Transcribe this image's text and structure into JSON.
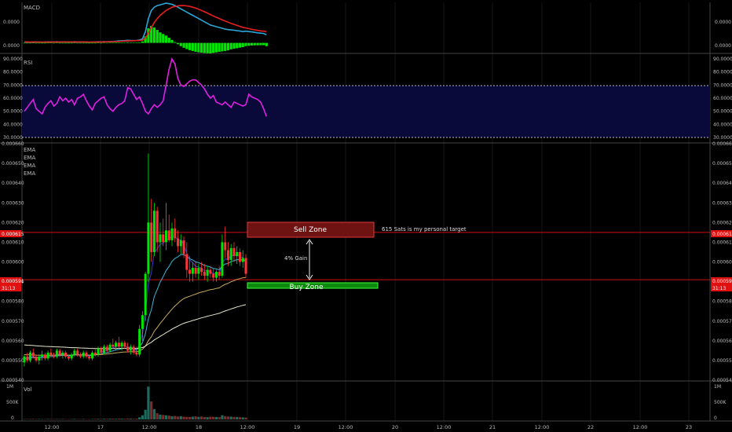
{
  "panels": {
    "macd": {
      "label": "MACD",
      "ticks": [
        "0.0000",
        "0.0000"
      ]
    },
    "rsi": {
      "label": "RSI",
      "ticks": [
        "90.0000",
        "80.0000",
        "70.0000",
        "60.0000",
        "50.0000",
        "40.0000",
        "30.0000"
      ]
    },
    "price": {
      "labels": [
        "EMA",
        "EMA",
        "EMA",
        "EMA"
      ]
    },
    "volume": {
      "label": "Vol",
      "ticks": [
        "1M",
        "500K",
        "0"
      ]
    }
  },
  "colors": {
    "bull": "#00e600",
    "bear": "#ff3333",
    "macd_line": "#2aa7d8",
    "signal_line": "#e82020",
    "rsi_line": "#e020e0",
    "rsi_band": "#0a0a3a",
    "ema1": "#3a36c8",
    "ema2": "#38b8d8",
    "ema3": "#c8a860",
    "ema4": "#e8e8d0",
    "level_line": "#cc1111",
    "sell_fill": "#6e1212",
    "buy_fill": "#0d8a0d"
  },
  "annotations": {
    "sell_zone": "Sell Zone",
    "buy_zone": "Buy Zone",
    "target_note": "615 Sats is my personal target",
    "gain_label": "4% Gain"
  },
  "levels": {
    "sell": {
      "label": "0.000615",
      "value": 0.000615
    },
    "buy": {
      "label": "0.000591",
      "value": 0.000591,
      "countdown": "31:13"
    }
  },
  "x_labels": [
    "12:00",
    "17",
    "12:00",
    "18",
    "12:00",
    "19",
    "12:00",
    "20",
    "12:00",
    "21",
    "12:00",
    "22",
    "12:00",
    "23"
  ],
  "chart_data": {
    "type": "candlestick",
    "price_axis": {
      "ticks": [
        0.00066,
        0.00065,
        0.00064,
        0.00063,
        0.00062,
        0.00061,
        0.0006,
        0.00059,
        0.00058,
        0.00057,
        0.00056,
        0.00055,
        0.00054
      ],
      "range": [
        0.00054,
        0.00066
      ]
    },
    "rsi": {
      "range": [
        30,
        90
      ],
      "overbought": 70,
      "oversold": 30,
      "values": [
        50,
        53,
        56,
        59,
        52,
        50,
        48,
        53,
        56,
        58,
        54,
        56,
        61,
        58,
        60,
        57,
        59,
        55,
        60,
        61,
        63,
        58,
        54,
        51,
        56,
        58,
        60,
        61,
        55,
        52,
        50,
        53,
        55,
        56,
        58,
        68,
        67,
        63,
        59,
        61,
        56,
        50,
        48,
        52,
        55,
        53,
        55,
        58,
        70,
        82,
        90,
        86,
        75,
        70,
        69,
        71,
        73,
        74,
        74,
        72,
        70,
        67,
        63,
        60,
        62,
        57,
        56,
        55,
        57,
        55,
        53,
        57,
        56,
        55,
        54,
        55,
        63,
        61,
        60,
        59,
        57,
        52,
        46
      ]
    },
    "macd": {
      "range": [
        -0.6,
        2.5
      ],
      "macd": [
        0.05,
        0.05,
        0.04,
        0.06,
        0.05,
        0.05,
        0.04,
        0.05,
        0.06,
        0.06,
        0.06,
        0.07,
        0.05,
        0.06,
        0.06,
        0.05,
        0.05,
        0.07,
        0.06,
        0.06,
        0.06,
        0.05,
        0.04,
        0.05,
        0.05,
        0.07,
        0.06,
        0.08,
        0.07,
        0.08,
        0.09,
        0.1,
        0.12,
        0.13,
        0.14,
        0.16,
        0.15,
        0.14,
        0.15,
        0.18,
        0.25,
        0.7,
        1.5,
        2.0,
        2.2,
        2.3,
        2.35,
        2.4,
        2.45,
        2.42,
        2.38,
        2.3,
        2.2,
        2.1,
        2.0,
        1.9,
        1.8,
        1.7,
        1.6,
        1.5,
        1.4,
        1.3,
        1.2,
        1.1,
        1.05,
        1.0,
        0.95,
        0.9,
        0.85,
        0.82,
        0.8,
        0.78,
        0.75,
        0.73,
        0.7,
        0.72,
        0.7,
        0.68,
        0.65,
        0.62,
        0.6,
        0.58,
        0.5
      ],
      "signal": [
        0.06,
        0.06,
        0.05,
        0.05,
        0.05,
        0.05,
        0.05,
        0.05,
        0.05,
        0.05,
        0.06,
        0.06,
        0.06,
        0.06,
        0.06,
        0.06,
        0.06,
        0.06,
        0.06,
        0.06,
        0.06,
        0.06,
        0.05,
        0.05,
        0.05,
        0.06,
        0.06,
        0.06,
        0.07,
        0.07,
        0.08,
        0.08,
        0.09,
        0.1,
        0.11,
        0.12,
        0.13,
        0.13,
        0.14,
        0.15,
        0.16,
        0.3,
        0.6,
        0.95,
        1.25,
        1.5,
        1.7,
        1.85,
        2.0,
        2.1,
        2.2,
        2.25,
        2.28,
        2.3,
        2.3,
        2.28,
        2.25,
        2.2,
        2.15,
        2.08,
        2.0,
        1.92,
        1.84,
        1.75,
        1.66,
        1.58,
        1.5,
        1.42,
        1.35,
        1.28,
        1.2,
        1.14,
        1.08,
        1.02,
        0.96,
        0.92,
        0.88,
        0.84,
        0.8,
        0.77,
        0.74,
        0.72,
        0.7
      ],
      "hist": [
        -0.01,
        -0.01,
        -0.01,
        0.01,
        0,
        0,
        -0.01,
        0,
        0.01,
        0.01,
        0,
        0.01,
        -0.01,
        0,
        0,
        -0.01,
        -0.01,
        0.01,
        0,
        0,
        0,
        -0.01,
        -0.01,
        0,
        0,
        0.01,
        0,
        0.02,
        0,
        0.01,
        0.01,
        0.02,
        0.03,
        0.03,
        0.03,
        0.04,
        0.02,
        0.01,
        0.01,
        0.03,
        0.09,
        0.4,
        0.9,
        1.05,
        0.95,
        0.8,
        0.65,
        0.55,
        0.45,
        0.32,
        0.18,
        0.05,
        -0.08,
        -0.2,
        -0.3,
        -0.38,
        -0.45,
        -0.5,
        -0.55,
        -0.58,
        -0.6,
        -0.62,
        -0.64,
        -0.65,
        -0.61,
        -0.58,
        -0.55,
        -0.52,
        -0.5,
        -0.46,
        -0.4,
        -0.36,
        -0.33,
        -0.29,
        -0.26,
        -0.2,
        -0.18,
        -0.16,
        -0.15,
        -0.15,
        -0.14,
        -0.14,
        -0.2
      ]
    },
    "ohlc": [
      [
        0.000549,
        0.000553,
        0.000547,
        0.000552
      ],
      [
        0.000552,
        0.000554,
        0.000549,
        0.00055
      ],
      [
        0.00055,
        0.000555,
        0.000549,
        0.000554
      ],
      [
        0.000554,
        0.000556,
        0.000551,
        0.000552
      ],
      [
        0.000552,
        0.000553,
        0.000549,
        0.00055
      ],
      [
        0.00055,
        0.000553,
        0.000548,
        0.000552
      ],
      [
        0.000552,
        0.000555,
        0.00055,
        0.000553
      ],
      [
        0.000553,
        0.000554,
        0.00055,
        0.000551
      ],
      [
        0.000551,
        0.000555,
        0.00055,
        0.000554
      ],
      [
        0.000554,
        0.000556,
        0.000552,
        0.000553
      ],
      [
        0.000553,
        0.000554,
        0.000551,
        0.000552
      ],
      [
        0.000552,
        0.000556,
        0.000551,
        0.000555
      ],
      [
        0.000555,
        0.000556,
        0.000552,
        0.000553
      ],
      [
        0.000553,
        0.000555,
        0.000551,
        0.000554
      ],
      [
        0.000554,
        0.000555,
        0.000551,
        0.000552
      ],
      [
        0.000552,
        0.000553,
        0.00055,
        0.000551
      ],
      [
        0.000551,
        0.000554,
        0.00055,
        0.000553
      ],
      [
        0.000553,
        0.000556,
        0.000552,
        0.000555
      ],
      [
        0.000555,
        0.000556,
        0.000552,
        0.000553
      ],
      [
        0.000553,
        0.000554,
        0.000551,
        0.000552
      ],
      [
        0.000552,
        0.000555,
        0.000551,
        0.000554
      ],
      [
        0.000554,
        0.000555,
        0.000551,
        0.000552
      ],
      [
        0.000552,
        0.000553,
        0.00055,
        0.000551
      ],
      [
        0.000551,
        0.000555,
        0.00055,
        0.000554
      ],
      [
        0.000554,
        0.000556,
        0.000552,
        0.000553
      ],
      [
        0.000553,
        0.000557,
        0.000552,
        0.000556
      ],
      [
        0.000556,
        0.000557,
        0.000553,
        0.000554
      ],
      [
        0.000554,
        0.000558,
        0.000553,
        0.000557
      ],
      [
        0.000557,
        0.000558,
        0.000554,
        0.000555
      ],
      [
        0.000555,
        0.000559,
        0.000554,
        0.000558
      ],
      [
        0.000558,
        0.000561,
        0.000556,
        0.000557
      ],
      [
        0.000557,
        0.00056,
        0.000555,
        0.000559
      ],
      [
        0.000559,
        0.000562,
        0.000556,
        0.000557
      ],
      [
        0.000557,
        0.00056,
        0.000555,
        0.000559
      ],
      [
        0.000559,
        0.00056,
        0.000556,
        0.000557
      ],
      [
        0.000557,
        0.000559,
        0.000554,
        0.000555
      ],
      [
        0.000555,
        0.000558,
        0.000553,
        0.000557
      ],
      [
        0.000557,
        0.000558,
        0.000553,
        0.000554
      ],
      [
        0.000554,
        0.000557,
        0.000552,
        0.000553
      ],
      [
        0.000553,
        0.000568,
        0.000552,
        0.000566
      ],
      [
        0.000566,
        0.000575,
        0.00056,
        0.000573
      ],
      [
        0.000573,
        0.000595,
        0.00057,
        0.000594
      ],
      [
        0.000594,
        0.000655,
        0.00059,
        0.00062
      ],
      [
        0.00062,
        0.000632,
        0.0006,
        0.000605
      ],
      [
        0.000605,
        0.00063,
        0.000603,
        0.000626
      ],
      [
        0.000626,
        0.000628,
        0.000605,
        0.00061
      ],
      [
        0.00061,
        0.00062,
        0.0006,
        0.000614
      ],
      [
        0.000614,
        0.000622,
        0.000608,
        0.00061
      ],
      [
        0.00061,
        0.00063,
        0.000606,
        0.000616
      ],
      [
        0.000616,
        0.000624,
        0.00061,
        0.000611
      ],
      [
        0.000611,
        0.00062,
        0.000608,
        0.000617
      ],
      [
        0.000617,
        0.000622,
        0.00061,
        0.000612
      ],
      [
        0.000612,
        0.000616,
        0.000605,
        0.000608
      ],
      [
        0.000608,
        0.000614,
        0.000604,
        0.000611
      ],
      [
        0.000611,
        0.000613,
        0.000602,
        0.000604
      ],
      [
        0.000604,
        0.00061,
        0.000592,
        0.000596
      ],
      [
        0.000596,
        0.000603,
        0.00059,
        0.000594
      ],
      [
        0.000594,
        0.0006,
        0.00059,
        0.000597
      ],
      [
        0.000597,
        0.0006,
        0.000592,
        0.000594
      ],
      [
        0.000594,
        0.000599,
        0.000591,
        0.000597
      ],
      [
        0.000597,
        0.0006,
        0.000593,
        0.000595
      ],
      [
        0.000595,
        0.000599,
        0.000591,
        0.000593
      ],
      [
        0.000593,
        0.000598,
        0.00059,
        0.000596
      ],
      [
        0.000596,
        0.000598,
        0.000592,
        0.000594
      ],
      [
        0.000594,
        0.000597,
        0.00059,
        0.000592
      ],
      [
        0.000592,
        0.000596,
        0.00059,
        0.000595
      ],
      [
        0.000595,
        0.000598,
        0.000591,
        0.000593
      ],
      [
        0.000593,
        0.000614,
        0.000592,
        0.00061
      ],
      [
        0.00061,
        0.000618,
        0.000602,
        0.000606
      ],
      [
        0.000606,
        0.00061,
        0.000598,
        0.000601
      ],
      [
        0.000601,
        0.000609,
        0.000598,
        0.000607
      ],
      [
        0.000607,
        0.00061,
        0.0006,
        0.000603
      ],
      [
        0.000603,
        0.000608,
        0.000599,
        0.000605
      ],
      [
        0.000605,
        0.000607,
        0.000598,
        0.0006
      ],
      [
        0.0006,
        0.000606,
        0.000597,
        0.000602
      ],
      [
        0.000602,
        0.000604,
        0.000592,
        0.000594
      ]
    ],
    "volume": [
      10,
      12,
      8,
      15,
      9,
      11,
      8,
      10,
      14,
      12,
      9,
      11,
      10,
      13,
      9,
      8,
      12,
      14,
      10,
      11,
      13,
      9,
      8,
      12,
      15,
      18,
      12,
      20,
      16,
      22,
      25,
      20,
      28,
      24,
      20,
      26,
      22,
      18,
      24,
      60,
      120,
      280,
      950,
      520,
      300,
      180,
      140,
      130,
      120,
      110,
      90,
      100,
      85,
      95,
      80,
      75,
      70,
      80,
      90,
      75,
      85,
      70,
      65,
      80,
      75,
      70,
      65,
      120,
      95,
      85,
      80,
      75,
      70,
      65,
      60,
      55
    ]
  }
}
